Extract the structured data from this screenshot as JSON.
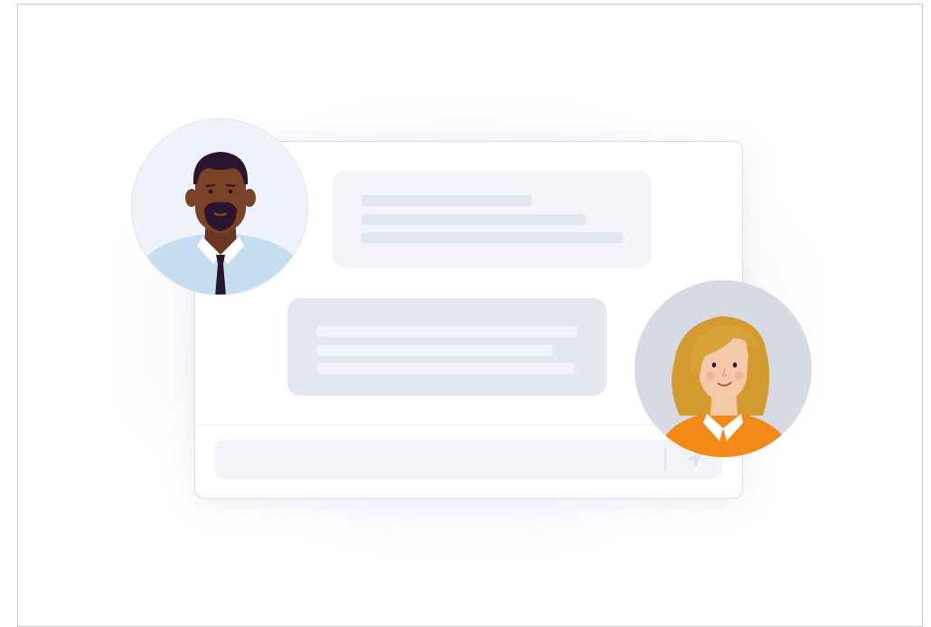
{
  "illustration": {
    "colors": {
      "bubble_light": "#f2f4fa",
      "bubble_dark": "#e4e7f0",
      "man_skin": "#7a4328",
      "man_hair": "#2a1530",
      "man_shirt": "#c4ddf0",
      "man_tie": "#2a1530",
      "woman_hair": "#d8a238",
      "woman_skin": "#f3c9a8",
      "woman_top": "#f38a17",
      "woman_bg": "#d7dae3"
    },
    "icons": {
      "send": "send-icon",
      "man": "man-avatar-icon",
      "woman": "woman-avatar-icon"
    }
  }
}
